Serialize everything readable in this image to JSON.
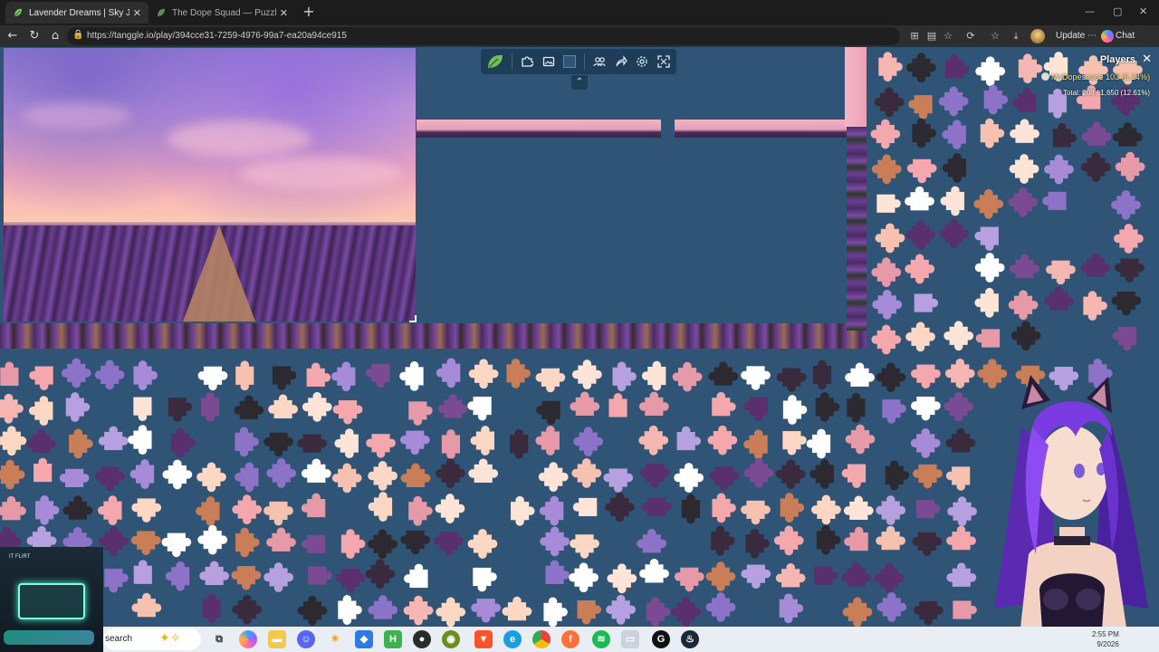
{
  "browser": {
    "tabs": [
      {
        "label": "Lavender Dreams | Sky Jigsaw",
        "active": true
      },
      {
        "label": "The Dope Squad — Puzzles",
        "active": false
      }
    ],
    "url": "https://tanggle.io/play/394cce31-7259-4976-99a7-ea20a94ce915",
    "update_label": "Update",
    "chat_label": "Chat",
    "new_tab_glyph": "+",
    "close_glyph": "✕"
  },
  "game": {
    "players_title": "Players",
    "player": {
      "name": "MsDopesauce",
      "stats": "103 (6.24%)"
    },
    "total": "Total: 208 / 1,650 (12.61%)",
    "board_color": "#2f5476"
  },
  "taskbar": {
    "search_label": "search",
    "clock_time": "2:55 PM",
    "clock_date": "9/2026"
  },
  "widget": {
    "title": "IT FLIRT"
  },
  "colors": {
    "accent": "#2f5476",
    "toolbar": "#1e3d59",
    "player_name": "#ffe48a"
  },
  "icons": {
    "toolbar": [
      "tanggle-logo-icon",
      "puzzle-piece-icon",
      "image-icon",
      "background-color-swatch",
      "players-icon",
      "share-icon",
      "settings-gear-icon",
      "fullscreen-icon"
    ]
  }
}
